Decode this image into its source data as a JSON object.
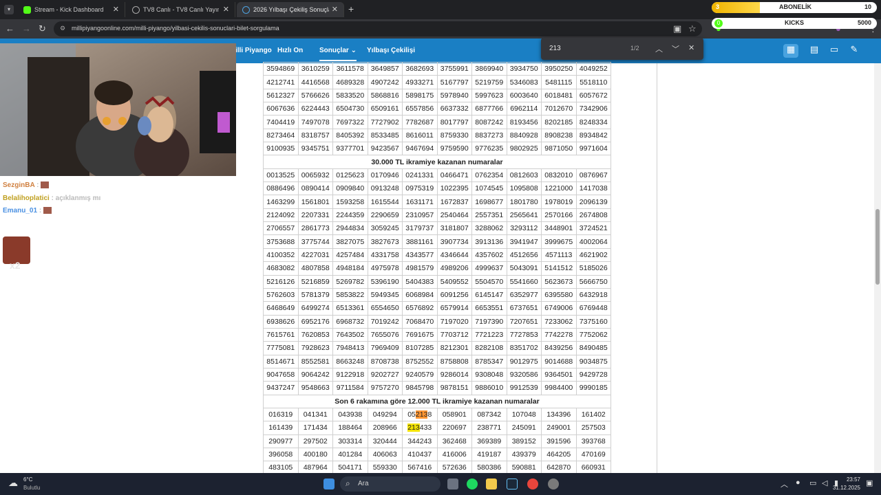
{
  "browser": {
    "tabs": [
      {
        "label": "Stream - Kick Dashboard",
        "active": false
      },
      {
        "label": "TV8 Canlı - TV8 Canlı Yayın İzle",
        "active": false
      },
      {
        "label": "2026 Yılbaşı Çekiliş Sonuçları, Y",
        "active": true
      }
    ],
    "new_tab": "+",
    "url": "millipiyangoonline.com/milli-piyango/yilbasi-cekilis-sonuclari-bilet-sorgulama"
  },
  "find": {
    "query": "213",
    "count": "1/2"
  },
  "site_nav": {
    "items": [
      "illi Piyango",
      "Hızlı On",
      "Sonuçlar",
      "Yılbaşı Çekilişi"
    ],
    "active_index": 2
  },
  "overlay": {
    "sub_count": "3",
    "sub_label": "ABONELİK",
    "sub_goal": "10",
    "kicks_label": "KICKS",
    "kicks_goal": "5000",
    "kicks_count": "0"
  },
  "chat": {
    "lines": [
      {
        "user": "SezginBA",
        "text": ":"
      },
      {
        "user": "Belalihoplatici",
        "text": ": açıklanmış mı"
      },
      {
        "user": "Emanu_01",
        "text": ":"
      }
    ],
    "badge": "x2"
  },
  "results": {
    "rows_top": [
      [
        "3594869",
        "3610259",
        "3611578",
        "3649857",
        "3682693",
        "3755991",
        "3869940",
        "3934750",
        "3950250",
        "4049252"
      ],
      [
        "4212741",
        "4416568",
        "4689328",
        "4907242",
        "4933271",
        "5167797",
        "5219759",
        "5346083",
        "5481115",
        "5518110"
      ],
      [
        "5612327",
        "5766626",
        "5833520",
        "5868816",
        "5898175",
        "5978940",
        "5997623",
        "6003640",
        "6018481",
        "6057672"
      ],
      [
        "6067636",
        "6224443",
        "6504730",
        "6509161",
        "6557856",
        "6637332",
        "6877766",
        "6962114",
        "7012670",
        "7342906"
      ],
      [
        "7404419",
        "7497078",
        "7697322",
        "7727902",
        "7782687",
        "8017797",
        "8087242",
        "8193456",
        "8202185",
        "8248334"
      ],
      [
        "8273464",
        "8318757",
        "8405392",
        "8533485",
        "8616011",
        "8759330",
        "8837273",
        "8840928",
        "8908238",
        "8934842"
      ],
      [
        "9100935",
        "9345751",
        "9377701",
        "9423567",
        "9467694",
        "9759590",
        "9776235",
        "9802925",
        "9871050",
        "9971604"
      ]
    ],
    "header_30k": "30.000 TL ikramiye kazanan numaralar",
    "rows_30k": [
      [
        "0013525",
        "0065932",
        "0125623",
        "0170946",
        "0241331",
        "0466471",
        "0762354",
        "0812603",
        "0832010",
        "0876967"
      ],
      [
        "0886496",
        "0890414",
        "0909840",
        "0913248",
        "0975319",
        "1022395",
        "1074545",
        "1095808",
        "1221000",
        "1417038"
      ],
      [
        "1463299",
        "1561801",
        "1593258",
        "1615544",
        "1631171",
        "1672837",
        "1698677",
        "1801780",
        "1978019",
        "2096139"
      ],
      [
        "2124092",
        "2207331",
        "2244359",
        "2290659",
        "2310957",
        "2540464",
        "2557351",
        "2565641",
        "2570166",
        "2674808"
      ],
      [
        "2706557",
        "2861773",
        "2944834",
        "3059245",
        "3179737",
        "3181807",
        "3288062",
        "3293112",
        "3448901",
        "3724521"
      ],
      [
        "3753688",
        "3775744",
        "3827075",
        "3827673",
        "3881161",
        "3907734",
        "3913136",
        "3941947",
        "3999675",
        "4002064"
      ],
      [
        "4100352",
        "4227031",
        "4257484",
        "4331758",
        "4343577",
        "4346644",
        "4357602",
        "4512656",
        "4571113",
        "4621902"
      ],
      [
        "4683082",
        "4807858",
        "4948184",
        "4975978",
        "4981579",
        "4989206",
        "4999637",
        "5043091",
        "5141512",
        "5185026"
      ],
      [
        "5216126",
        "5216859",
        "5269782",
        "5396190",
        "5404383",
        "5409552",
        "5504570",
        "5541660",
        "5623673",
        "5666750"
      ],
      [
        "5762603",
        "5781379",
        "5853822",
        "5949345",
        "6068984",
        "6091256",
        "6145147",
        "6352977",
        "6395580",
        "6432918"
      ],
      [
        "6468649",
        "6499274",
        "6513361",
        "6554650",
        "6576892",
        "6579914",
        "6653551",
        "6737651",
        "6749006",
        "6769448"
      ],
      [
        "6938626",
        "6952176",
        "6968732",
        "7019242",
        "7068470",
        "7197020",
        "7197390",
        "7207651",
        "7233062",
        "7375160"
      ],
      [
        "7615761",
        "7620853",
        "7643502",
        "7655076",
        "7691675",
        "7703712",
        "7721223",
        "7727853",
        "7742278",
        "7752062"
      ],
      [
        "7775081",
        "7928623",
        "7948413",
        "7969409",
        "8107285",
        "8212301",
        "8282108",
        "8351702",
        "8439256",
        "8490485"
      ],
      [
        "8514671",
        "8552581",
        "8663248",
        "8708738",
        "8752552",
        "8758808",
        "8785347",
        "9012975",
        "9014688",
        "9034875"
      ],
      [
        "9047658",
        "9064242",
        "9122918",
        "9202727",
        "9240579",
        "9286014",
        "9308048",
        "9320586",
        "9364501",
        "9429728"
      ],
      [
        "9437247",
        "9548663",
        "9711584",
        "9757270",
        "9845798",
        "9878151",
        "9886010",
        "9912539",
        "9984400",
        "9990185"
      ]
    ],
    "header_12k": "Son 6 rakamına göre 12.000 TL ikramiye kazanan numaralar",
    "rows_12k": [
      [
        "016319",
        "041341",
        "043938",
        "049294",
        "052138",
        "058901",
        "087342",
        "107048",
        "134396",
        "161402"
      ],
      [
        "161439",
        "171434",
        "188464",
        "208966",
        "213433",
        "220697",
        "238771",
        "245091",
        "249001",
        "257503"
      ],
      [
        "290977",
        "297502",
        "303314",
        "320444",
        "344243",
        "362468",
        "369389",
        "389152",
        "391596",
        "393768"
      ],
      [
        "396058",
        "400180",
        "401284",
        "406063",
        "410437",
        "416006",
        "419187",
        "439379",
        "464205",
        "470169"
      ],
      [
        "483105",
        "487964",
        "504171",
        "559330",
        "567416",
        "572636",
        "580386",
        "590881",
        "642870",
        "660931"
      ]
    ]
  },
  "taskbar": {
    "weather_temp": "6°C",
    "weather_label": "Bulutlu",
    "search_label": "Ara",
    "time": "23:57",
    "date": "31.12.2025"
  },
  "colors": {
    "site_blue": "#1a7fc4",
    "find_current": "#ff9632",
    "find_match": "#f5e400"
  }
}
